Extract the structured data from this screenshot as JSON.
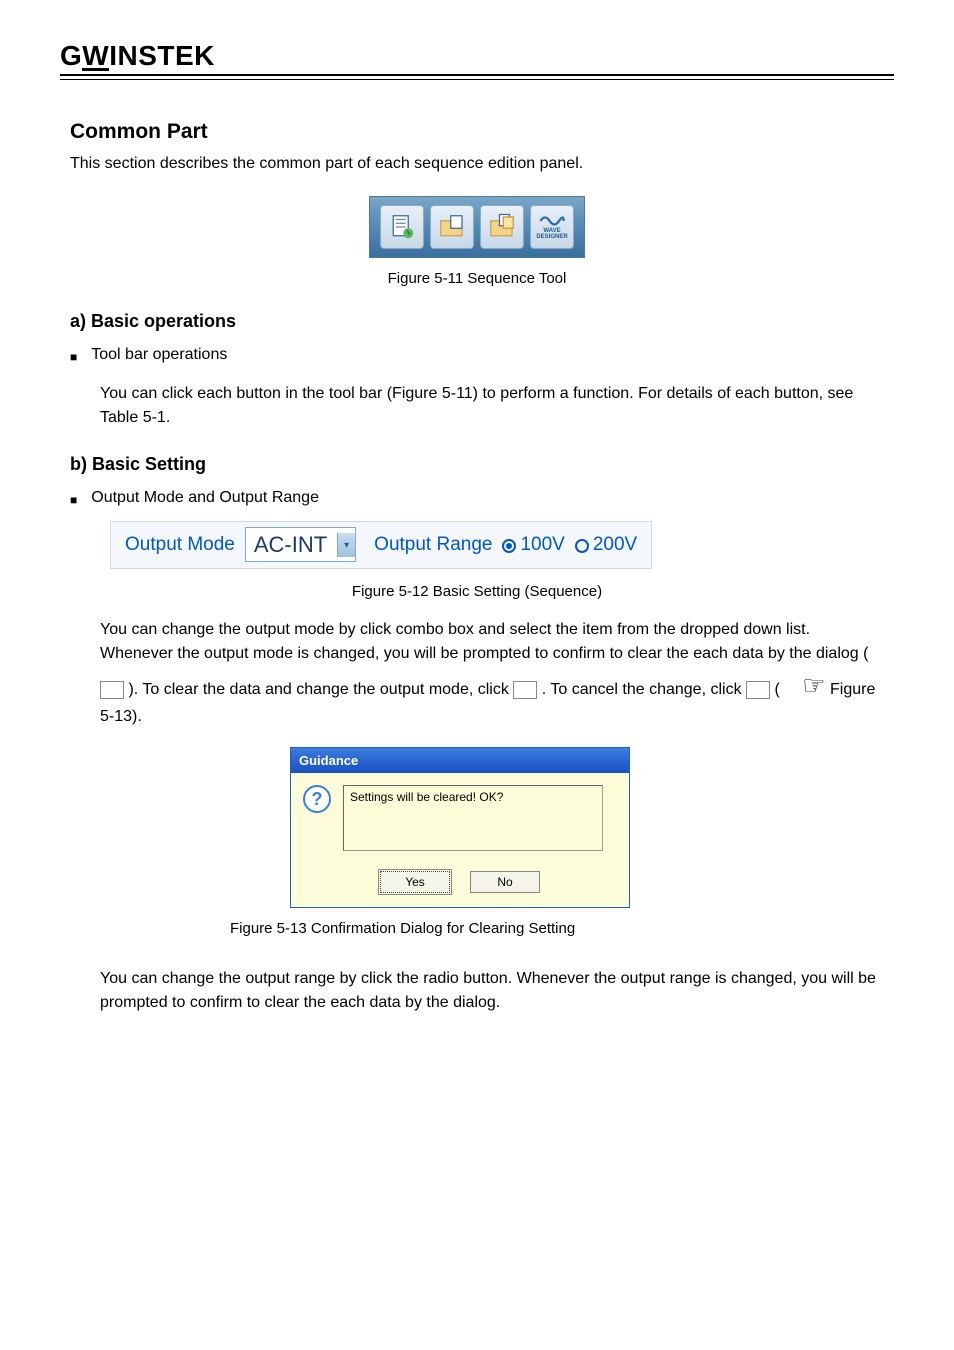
{
  "header": {
    "logo_left": "G",
    "logo_w": "W",
    "logo_right": "INSTEK"
  },
  "section": {
    "title": "Common Part",
    "intro": "This section describes the common part of each sequence edition panel."
  },
  "toolbar": {
    "icons": [
      "new-icon",
      "open-icon",
      "open-multi-icon",
      "wave-designer-icon"
    ],
    "wave_label_top": "WAVE",
    "wave_label_bottom": "DESIGNER",
    "caption": "Figure 5-11 Sequence Tool"
  },
  "section_a": {
    "heading": "a) Basic operations",
    "subheading": "Tool bar operations",
    "para1_part1": "You can click each button in the tool bar (Figure 5-11) to perform a function. For details of each button, see ",
    "para1_link": "Table 5-1",
    "para1_part2": "."
  },
  "section_b": {
    "heading": "b) Basic Setting",
    "bullet_label": "Output Mode and Output Range"
  },
  "output_panel": {
    "mode_label": "Output Mode",
    "mode_value": "AC-INT",
    "range_label": "Output Range",
    "range_100": "100V",
    "range_200": "200V",
    "caption": "Figure 5-12 Basic Setting (Sequence)"
  },
  "body_text": {
    "p1_a": "You can change the output mode by click combo box and select the item from the dropped down list. Whenever the output mode is changed, you will be prompted to confirm to clear the each data by the dialog (",
    "p1_b": "). To clear the data and change the output mode, click",
    "p1_c": ". To cancel the change, click",
    "p1_d": "(",
    "p1_e": "Figure 5-13)."
  },
  "dialog": {
    "title": "Guidance",
    "message": "Settings will be cleared! OK?",
    "yes": "Yes",
    "no": "No",
    "caption": "Figure 5-13 Confirmation Dialog for Clearing Setting"
  },
  "body_text2": {
    "p2": "You can change the output range by click the radio button. Whenever the output range is changed, you will be prompted to confirm to clear the each data by the dialog."
  }
}
